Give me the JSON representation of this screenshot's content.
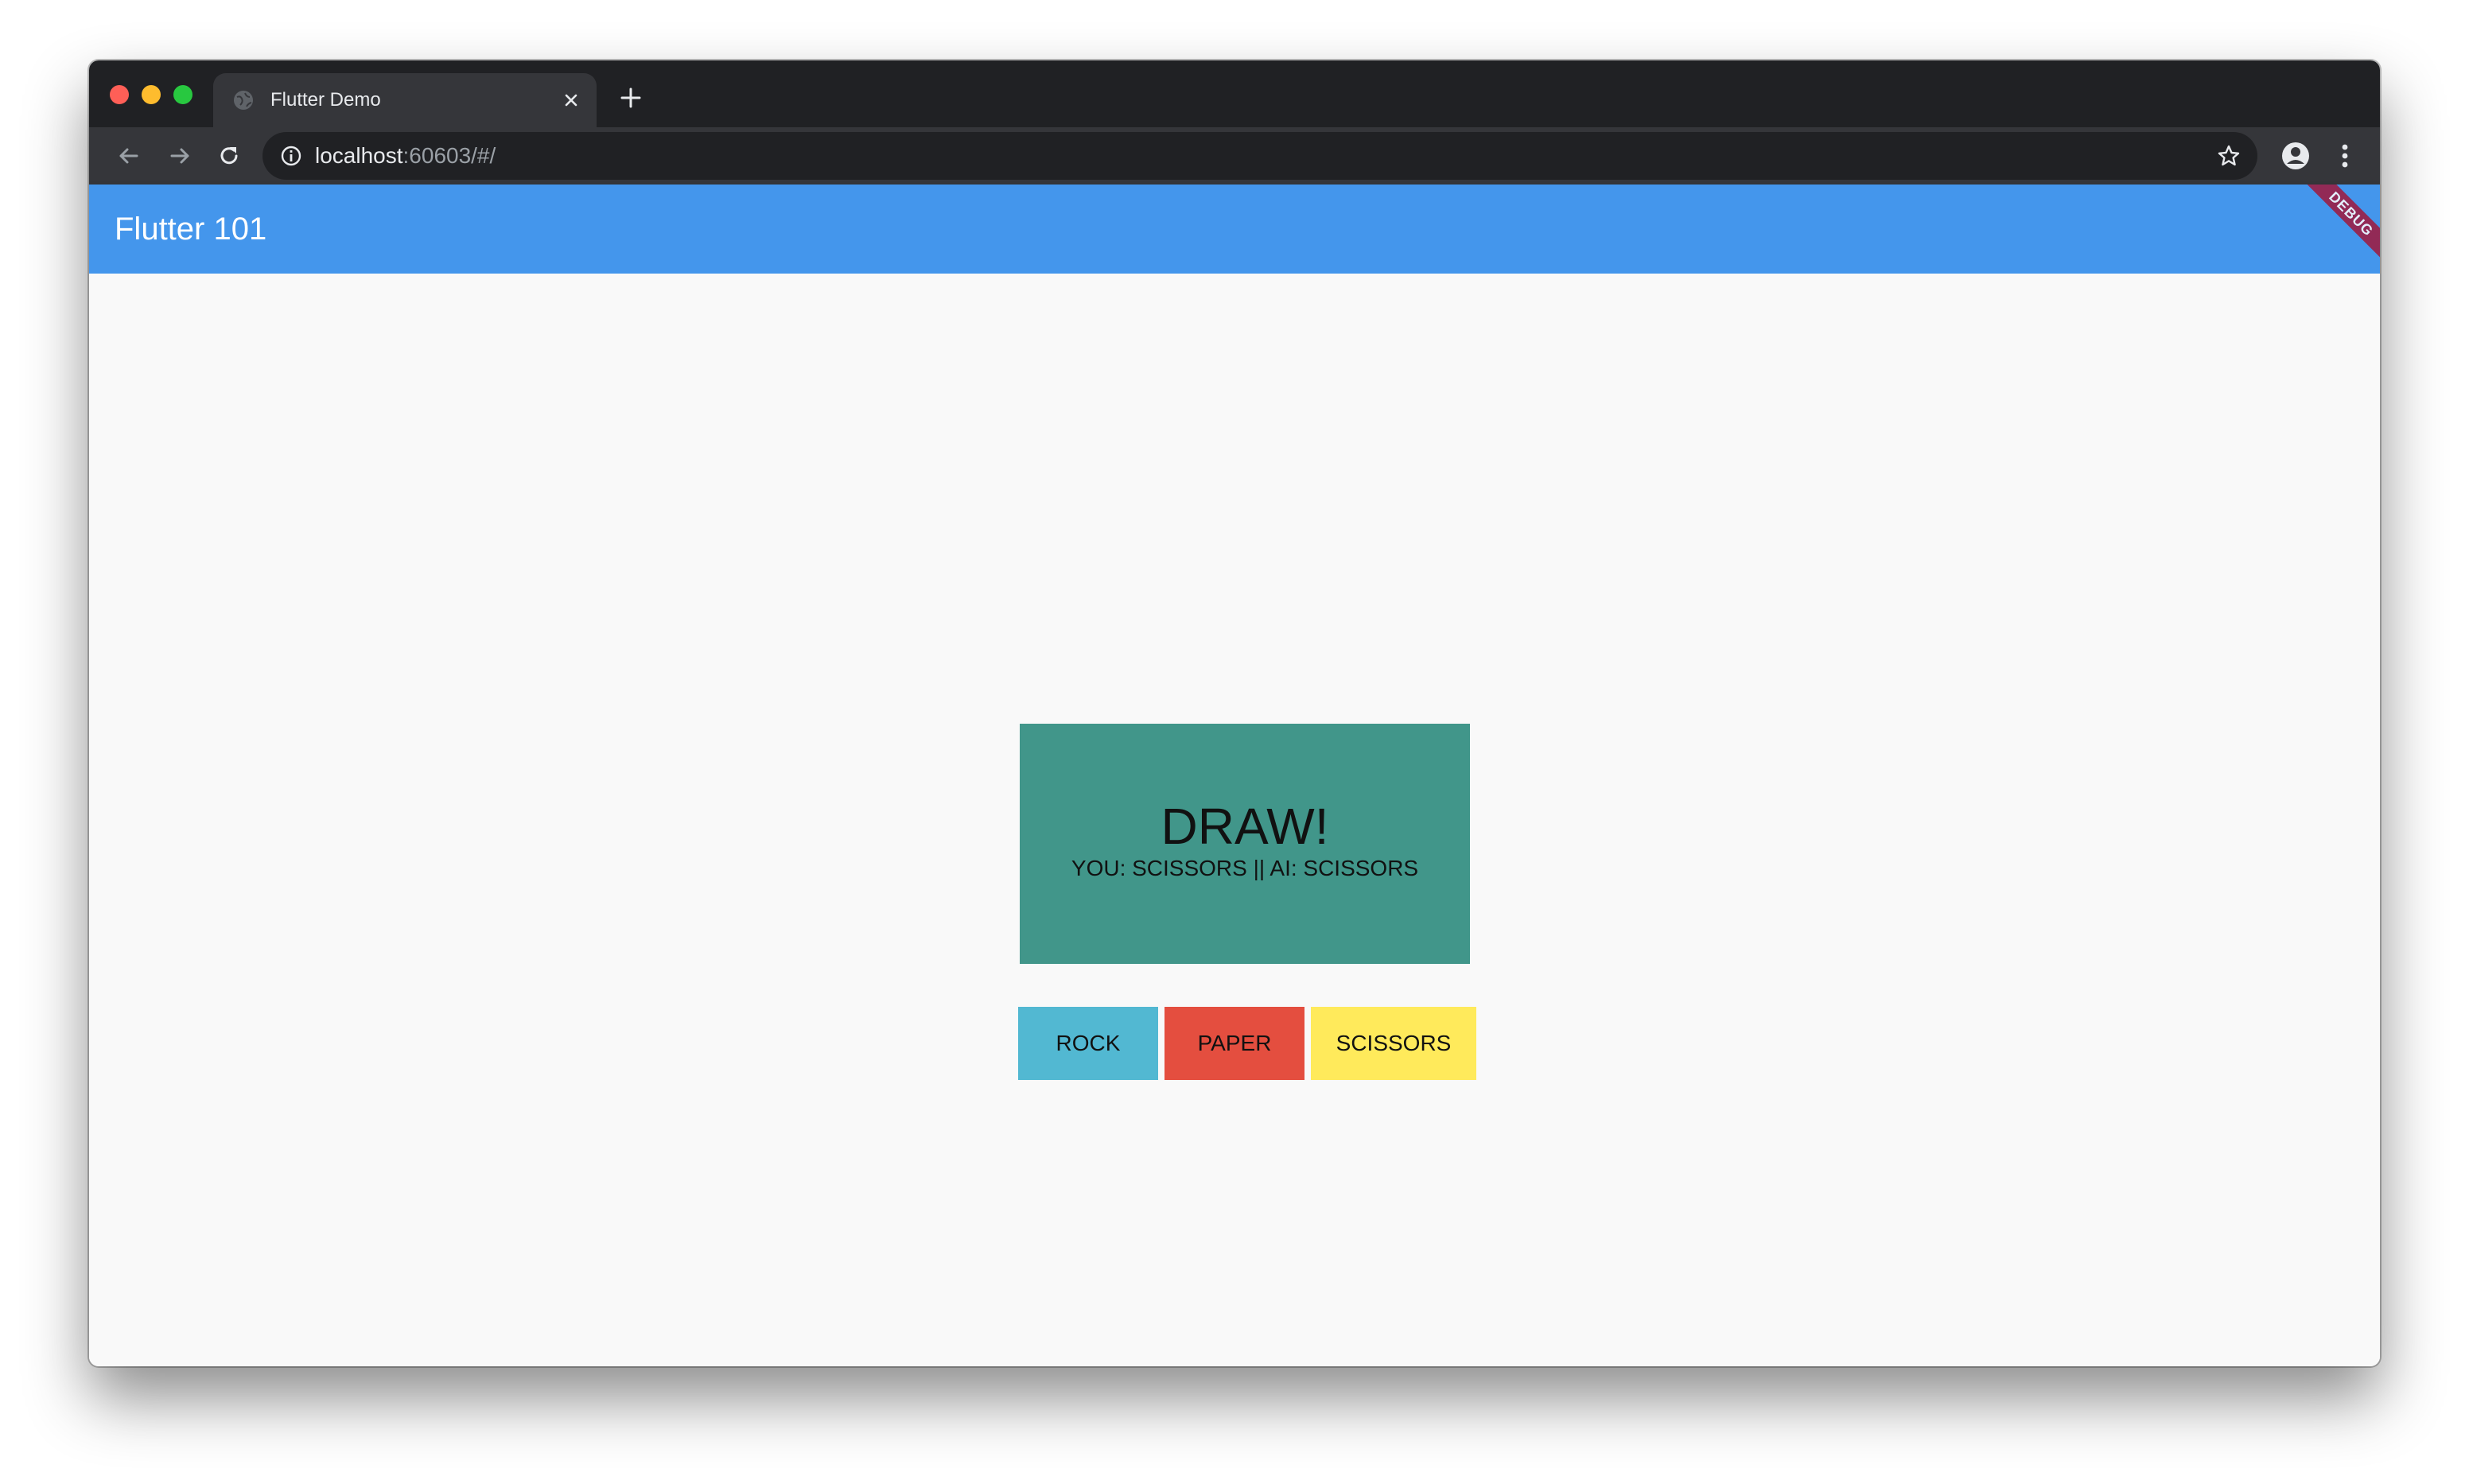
{
  "browser": {
    "tab": {
      "title": "Flutter Demo"
    },
    "address": {
      "host": "localhost",
      "rest": ":60603/#/"
    }
  },
  "app": {
    "title": "Flutter 101",
    "debug_banner": "DEBUG",
    "accent_color": "#4496ec"
  },
  "game": {
    "result": "DRAW!",
    "detail": "YOU: SCISSORS || AI: SCISSORS",
    "result_color": "#41968a",
    "buttons": [
      {
        "label": "ROCK",
        "color": "#52b8d2"
      },
      {
        "label": "PAPER",
        "color": "#e44e3f"
      },
      {
        "label": "SCISSORS",
        "color": "#ffea5b"
      }
    ]
  }
}
